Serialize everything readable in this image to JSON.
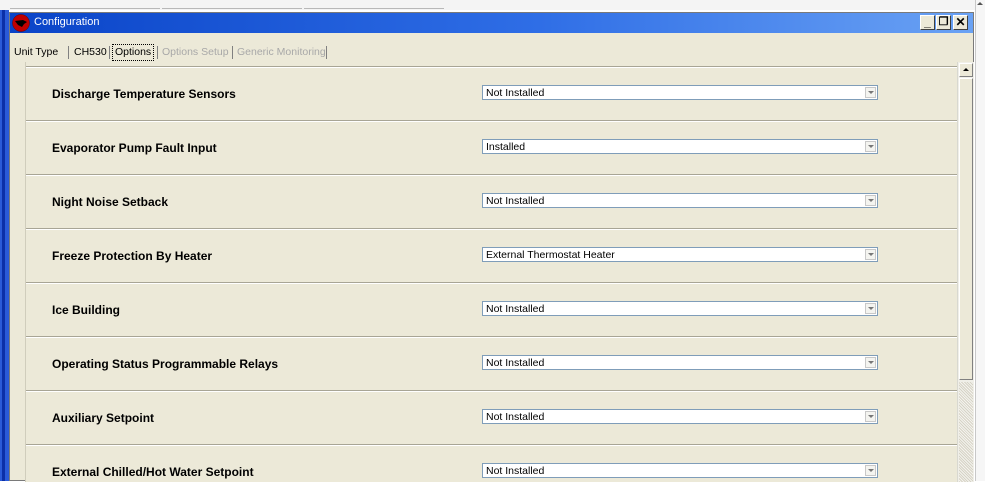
{
  "window": {
    "title": "Configuration",
    "buttons": {
      "minimize": "_",
      "restore": "❐",
      "close": "✕"
    }
  },
  "tabs": [
    {
      "label": "Unit Type",
      "state": "normal"
    },
    {
      "label": "CH530",
      "state": "normal"
    },
    {
      "label": "Options",
      "state": "active"
    },
    {
      "label": "Options Setup",
      "state": "disabled"
    },
    {
      "label": "Generic Monitoring",
      "state": "disabled"
    }
  ],
  "options": [
    {
      "label": "Discharge Temperature Sensors",
      "value": "Not Installed"
    },
    {
      "label": "Evaporator Pump Fault Input",
      "value": "Installed"
    },
    {
      "label": "Night Noise Setback",
      "value": "Not Installed"
    },
    {
      "label": "Freeze Protection By Heater",
      "value": "External Thermostat Heater"
    },
    {
      "label": "Ice Building",
      "value": "Not Installed"
    },
    {
      "label": "Operating Status Programmable Relays",
      "value": "Not Installed"
    },
    {
      "label": "Auxiliary Setpoint",
      "value": "Not Installed"
    },
    {
      "label": "External Chilled/Hot Water Setpoint",
      "value": "Not Installed"
    }
  ],
  "colors": {
    "titlebar_start": "#0a44c8",
    "titlebar_end": "#6aa2f4",
    "panel_bg": "#ece9d8",
    "select_border": "#7f9db9"
  },
  "icons": {
    "app": "app-logo-icon",
    "dropdown": "chevron-down-icon",
    "scroll_up": "scroll-up-arrow-icon"
  }
}
